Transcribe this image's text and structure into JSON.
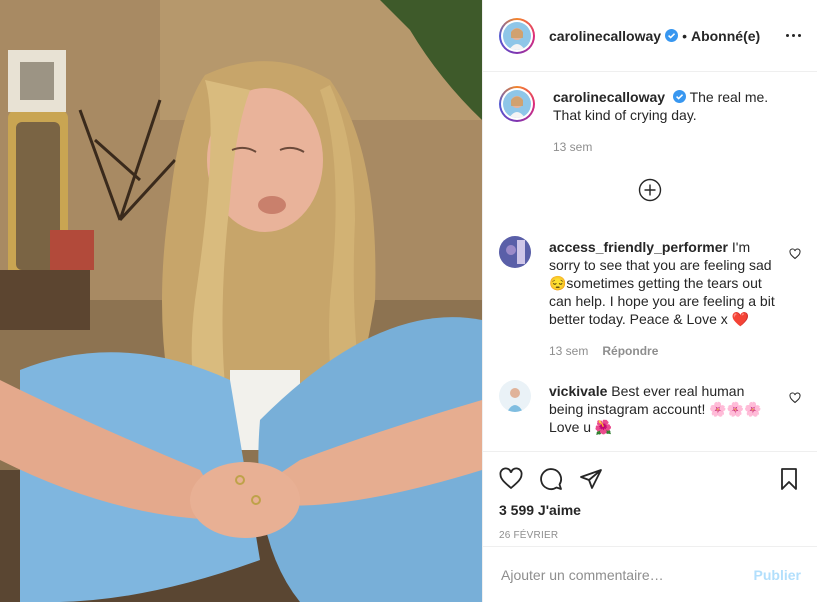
{
  "post": {
    "author": {
      "username": "carolinecalloway",
      "verified_icon": "verified-badge-icon",
      "separator": "•",
      "follow_status": "Abonné(e)"
    },
    "caption": {
      "username": "carolinecalloway",
      "text": "The real me. That kind of crying day.",
      "time": "13 sem"
    },
    "load_more_icon": "plus-circle-icon",
    "comments": [
      {
        "username": "access_friendly_performer",
        "text": "I'm sorry to see that you are feeling sad 😔sometimes getting the tears out can help. I hope you are feeling a bit better today. Peace & Love x ❤️",
        "time": "13 sem",
        "reply_label": "Répondre"
      },
      {
        "username": "vickivale",
        "text": "Best ever real human being instagram account! 🌸🌸🌸 Love u 🌺",
        "time": "",
        "reply_label": ""
      }
    ],
    "likes": "3 599 J'aime",
    "date": "26 FÉVRIER",
    "comment_input": {
      "placeholder": "Ajouter un commentaire…",
      "value": ""
    },
    "publish_label": "Publier"
  },
  "colors": {
    "verified": "#3897f0",
    "publish_disabled": "#b2dffc",
    "secondary_text": "#8e8e8e",
    "pants": "#7fb6df"
  }
}
